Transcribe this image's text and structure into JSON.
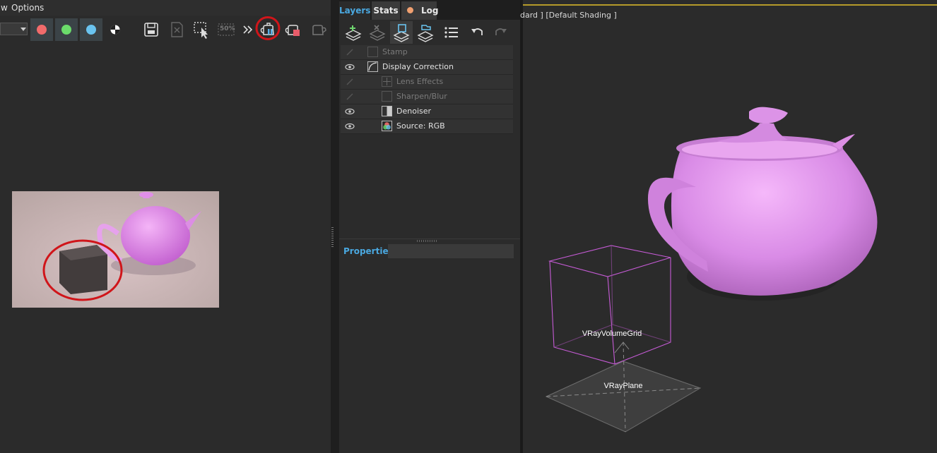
{
  "menu": {
    "view_fragment": "w",
    "options": "Options"
  },
  "channels": [
    {
      "name": "red",
      "color": "#f06b6b"
    },
    {
      "name": "green",
      "color": "#6bdc6b"
    },
    {
      "name": "blue",
      "color": "#6ac4f0"
    }
  ],
  "toolbar": {
    "percent_label": "50%"
  },
  "tabs": {
    "layers": "Layers",
    "stats": "Stats",
    "log": "Log"
  },
  "layers": [
    {
      "label": "Stamp",
      "visible": false,
      "enabled": false,
      "icon": "stamp-icon"
    },
    {
      "label": "Display Correction",
      "visible": true,
      "enabled": true,
      "icon": "curve-icon"
    },
    {
      "label": "Lens Effects",
      "visible": false,
      "enabled": false,
      "icon": "lens-icon"
    },
    {
      "label": "Sharpen/Blur",
      "visible": false,
      "enabled": false,
      "icon": "sharpen-icon"
    },
    {
      "label": "Denoiser",
      "visible": true,
      "enabled": true,
      "icon": "denoiser-icon"
    },
    {
      "label": "Source: RGB",
      "visible": true,
      "enabled": true,
      "icon": "rgb-icon"
    }
  ],
  "properties": {
    "title": "Properties"
  },
  "viewport": {
    "label": "dard ] [Default Shading ]",
    "object_volume": "VRayVolumeGrid",
    "object_plane": "VRayPlane"
  },
  "colors": {
    "accent": "#4aa8e0",
    "highlight_circle": "#d0151a",
    "teapot": "#d98be6"
  }
}
